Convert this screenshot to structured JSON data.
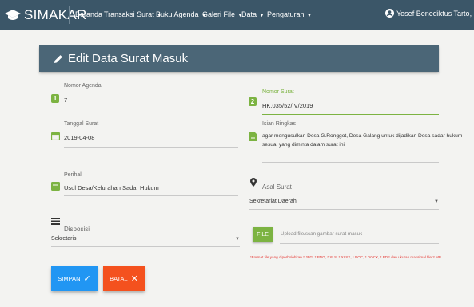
{
  "brand": {
    "name": "SIMAKAR"
  },
  "nav": {
    "items": [
      {
        "label": "Beranda",
        "dropdown": false
      },
      {
        "label": "Transaksi Surat",
        "dropdown": true
      },
      {
        "label": "Buku Agenda",
        "dropdown": true
      },
      {
        "label": "Galeri File",
        "dropdown": true
      },
      {
        "label": "Data",
        "dropdown": true
      },
      {
        "label": "Pengaturan",
        "dropdown": true
      }
    ],
    "user": "Yosef Benediktus Tarto, S.Pt"
  },
  "form": {
    "title": "Edit Data Surat Masuk",
    "nomor_agenda": {
      "label": "Nomor Agenda",
      "value": "7",
      "icon_text": "1"
    },
    "nomor_surat": {
      "label": "Nomor Surat",
      "value": "HK.035/52/IV/2019",
      "icon_text": "2"
    },
    "tanggal_surat": {
      "label": "Tanggal Surat",
      "value": "2019-04-08"
    },
    "isian_ringkas": {
      "label": "Isian Ringkas",
      "line1": "agar mengusulkan Desa G.Ronggot, Desa Galang untuk dijadikan Desa sadar hukum",
      "line2": "sesuai yang diminta dalam surat ini"
    },
    "perihal": {
      "label": "Perihal",
      "value": "Usul Desa/Kelurahan Sadar Hukum"
    },
    "asal_surat": {
      "label": "Asal Surat",
      "value": "Sekretariat Daerah"
    },
    "disposisi": {
      "label": "Disposisi",
      "value": "Sekretaris"
    },
    "file": {
      "button": "FILE",
      "placeholder": "Upload file/scan gambar surat masuk",
      "note": "*Format file yang diperbolehkan *.JPG, *.PNG, *.XLS, *.XLSX, *.DOC, *.DOCX, *.PDF dan ukuran maksimal file 2 MB"
    },
    "buttons": {
      "save": "SIMPAN",
      "cancel": "BATAL"
    }
  },
  "colors": {
    "navbar": "#3b5668",
    "header": "#4b6677",
    "accent": "#7cb342",
    "save": "#2196f3",
    "cancel": "#f4511e"
  }
}
